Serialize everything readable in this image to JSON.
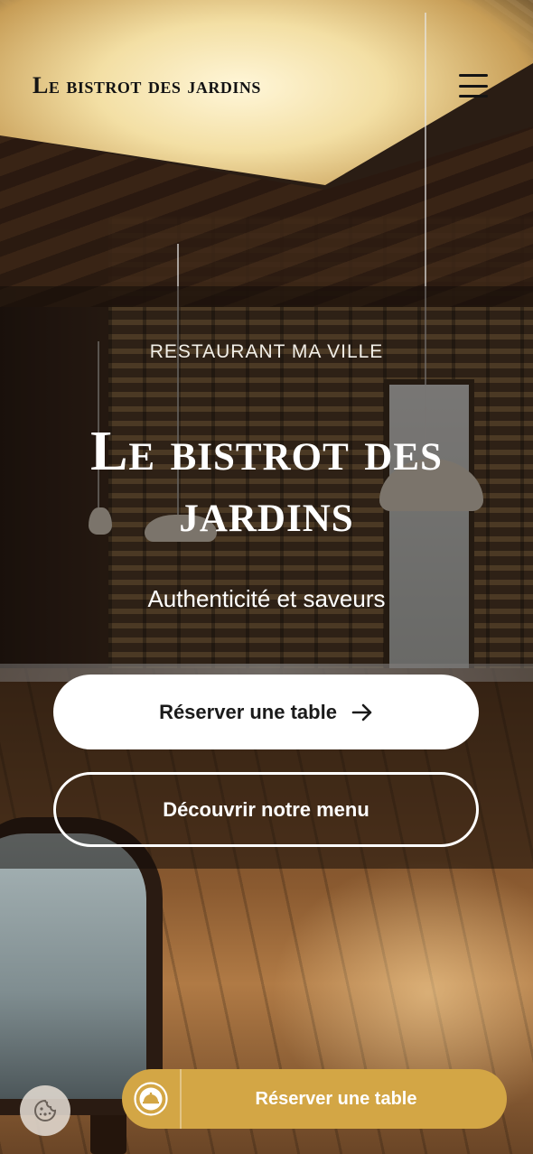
{
  "header": {
    "brand": "Le bistrot des jardins",
    "menu_icon": "hamburger-menu-icon"
  },
  "hero": {
    "eyebrow": "RESTAURANT MA VILLE",
    "title": "Le bistrot des jardins",
    "subtitle": "Authenticité et saveurs",
    "primary_cta": "Réserver une table",
    "primary_cta_icon": "arrow-right-icon",
    "secondary_cta": "Découvrir notre menu"
  },
  "sticky_bar": {
    "cookie_icon": "cookie-icon",
    "booking_icon": "cloche-icon",
    "booking_label": "Réserver une table"
  },
  "colors": {
    "accent_gold": "#d3a645",
    "text_light": "#ffffff",
    "text_dark": "#141414",
    "overlay": "rgba(18,12,8,0.52)"
  }
}
